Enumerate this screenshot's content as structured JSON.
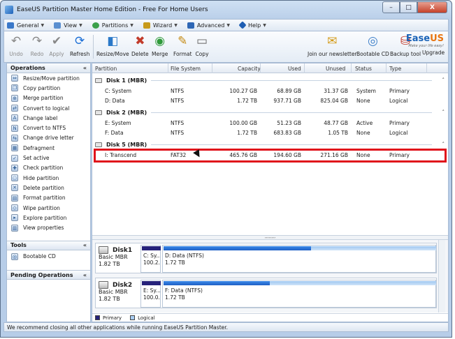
{
  "window": {
    "title": "EaseUS Partition Master Home Edition - Free For Home Users",
    "min": "–",
    "max": "□",
    "close": "X"
  },
  "menu": [
    {
      "label": "General",
      "icon": "general-icon",
      "color": "#3a78c9"
    },
    {
      "label": "View",
      "icon": "view-icon",
      "color": "#5a8fd0"
    },
    {
      "label": "Partitions",
      "icon": "partitions-icon",
      "color": "#3aa04a"
    },
    {
      "label": "Wizard",
      "icon": "wizard-icon",
      "color": "#c79a1a"
    },
    {
      "label": "Advanced",
      "icon": "advanced-icon",
      "color": "#2e67b5"
    },
    {
      "label": "Help",
      "icon": "help-icon",
      "color": "#1d5db3"
    }
  ],
  "toolbar": {
    "undo": "Undo",
    "redo": "Redo",
    "apply": "Apply",
    "refresh": "Refresh",
    "resize_move": "Resize/Move",
    "delete": "Delete",
    "merge": "Merge",
    "format": "Format",
    "copy": "Copy",
    "newsletter": "Join our newsletter",
    "bootable_cd": "Bootable CD",
    "backup_tool": "Backup tool",
    "upgrade": "Upgrade"
  },
  "logo": {
    "brand_a": "Ease",
    "brand_b": "US",
    "tagline": "Make your life easy!"
  },
  "operations": {
    "title": "Operations",
    "collapse": "«",
    "items": [
      "Resize/Move partition",
      "Copy partition",
      "Merge partition",
      "Convert to logical",
      "Change label",
      "Convert to NTFS",
      "Change drive letter",
      "Defragment",
      "Set active",
      "Check partition",
      "Hide partition",
      "Delete partition",
      "Format partition",
      "Wipe partition",
      "Explore partition",
      "View properties"
    ]
  },
  "tools": {
    "title": "Tools",
    "collapse": "«",
    "items": [
      "Bootable CD"
    ]
  },
  "pending": {
    "title": "Pending Operations",
    "collapse": "«"
  },
  "table": {
    "headers": [
      "Partition",
      "File System",
      "Capacity",
      "Used",
      "Unused",
      "Status",
      "Type"
    ],
    "disks": [
      {
        "label": "Disk 1 (MBR)",
        "rows": [
          {
            "partition": "C: System",
            "fs": "NTFS",
            "capacity": "100.27 GB",
            "used": "68.89 GB",
            "unused": "31.37 GB",
            "status": "System",
            "type": "Primary"
          },
          {
            "partition": "D: Data",
            "fs": "NTFS",
            "capacity": "1.72 TB",
            "used": "937.71 GB",
            "unused": "825.04 GB",
            "status": "None",
            "type": "Logical"
          }
        ]
      },
      {
        "label": "Disk 2 (MBR)",
        "rows": [
          {
            "partition": "E: System",
            "fs": "NTFS",
            "capacity": "100.00 GB",
            "used": "51.23 GB",
            "unused": "48.77 GB",
            "status": "Active",
            "type": "Primary"
          },
          {
            "partition": "F: Data",
            "fs": "NTFS",
            "capacity": "1.72 TB",
            "used": "683.83 GB",
            "unused": "1.05 TB",
            "status": "None",
            "type": "Logical"
          }
        ]
      },
      {
        "label": "Disk 5 (MBR)",
        "rows": [
          {
            "partition": "I: Transcend",
            "fs": "FAT32",
            "capacity": "465.76 GB",
            "used": "194.60 GB",
            "unused": "271.16 GB",
            "status": "None",
            "type": "Primary"
          }
        ]
      }
    ]
  },
  "splitter": ",,,,,,,,",
  "disk_map": [
    {
      "name": "Disk1",
      "kind": "Basic MBR",
      "size": "1.82 TB",
      "p1_label": "C: Sy...",
      "p1_size": "100.2...",
      "p2_label": "D: Data (NTFS)",
      "p2_size": "1.72 TB",
      "p2_used_fraction": 0.54
    },
    {
      "name": "Disk2",
      "kind": "Basic MBR",
      "size": "1.82 TB",
      "p1_label": "E: Sy...",
      "p1_size": "100.0...",
      "p2_label": "F: Data (NTFS)",
      "p2_size": "1.72 TB",
      "p2_used_fraction": 0.39
    }
  ],
  "legend": {
    "primary": "Primary",
    "logical": "Logical",
    "primary_color": "#26227a",
    "logical_color": "#a7ccf2"
  },
  "status": "We recommend closing all other applications while running EaseUS Partition Master."
}
